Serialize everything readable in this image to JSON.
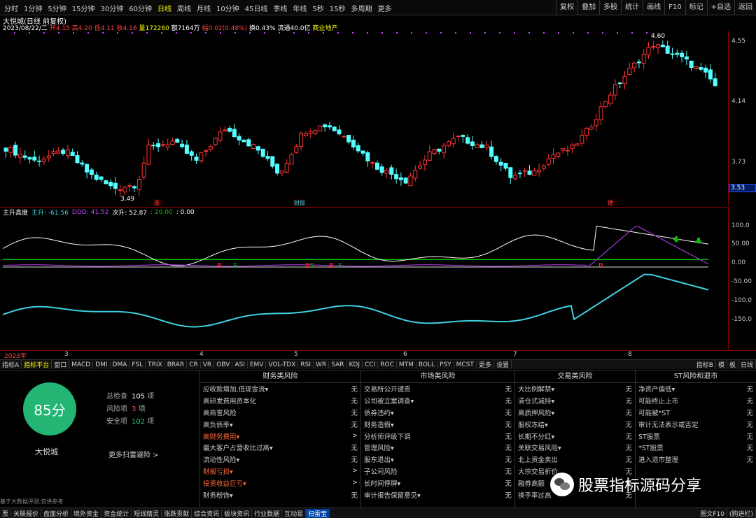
{
  "topbar": {
    "periods": [
      "分时",
      "1分钟",
      "5分钟",
      "15分钟",
      "30分钟",
      "60分钟",
      "日线",
      "周线",
      "月线",
      "10分钟",
      "45日线",
      "季线",
      "年线",
      "5秒",
      "15秒",
      "多周期",
      "更多"
    ],
    "active_period": "日线",
    "right": [
      "复权",
      "叠加",
      "多股",
      "统计",
      "画线",
      "F10",
      "标记",
      "+自选",
      "返回"
    ]
  },
  "stock": {
    "title": "大悦城(日线 前复权)",
    "date": "2023/08/22/二",
    "open": "开4.15",
    "high": "高4.20",
    "low": "低4.11",
    "close": "收4.16",
    "volume": "量172260",
    "amount": "额7164万",
    "change": "幅0.02(0.48%)",
    "turnover": "换0.43%",
    "float": "流通40.0亿",
    "sector": "商业地产"
  },
  "price_axis": [
    "4.55",
    "4.14",
    "3.73",
    "3.53"
  ],
  "current_price": "3.53",
  "annotations": {
    "high": "4.60",
    "low": "3.49",
    "tag_zhang": "涨",
    "tag_report": "财报",
    "tag_hui": "德"
  },
  "indicator": {
    "name": "主升高度",
    "z1": "主升: -61.56",
    "z2": "DDD: 41.52",
    "z3": "次升: 52.87",
    "z4": ": 20.00",
    "z5": ": 0.00",
    "axis": [
      "100.0",
      "50.00",
      "0.00",
      "-50.00",
      "-100.0",
      "-150.0"
    ]
  },
  "date_axis": [
    "2023年",
    "3",
    "4",
    "5",
    "6",
    "7",
    "8"
  ],
  "tabs": {
    "left": [
      "指标A",
      "指标平台",
      "窗口",
      "MACD",
      "DMI",
      "DMA",
      "FSL",
      "TRIX",
      "BRAR",
      "CR",
      "VR",
      "OBV",
      "ASI",
      "EMV",
      "VOL-TDX",
      "RSI",
      "WR",
      "SAR",
      "KDJ",
      "CCI",
      "ROC",
      "MTM",
      "BOLL",
      "PSY",
      "MCST",
      "更多",
      "设置"
    ],
    "active": "指标平台",
    "right": [
      "指标B",
      "模",
      "板",
      "日线"
    ]
  },
  "panel": {
    "score": "85分",
    "name": "大悦城",
    "total": {
      "label": "总检查",
      "value": "105",
      "unit": "项"
    },
    "risk": {
      "label": "风险项",
      "value": "3",
      "unit": "项"
    },
    "safe": {
      "label": "安全项",
      "value": "102",
      "unit": "项"
    },
    "more": "更多扫雷避险 >",
    "footnote": "基于大数据评测,仅供参考",
    "columns": [
      {
        "title": "财务类风险",
        "items": [
          {
            "label": "应收款增加,低现金流▾",
            "value": "无"
          },
          {
            "label": "高研发费用资本化",
            "value": "无"
          },
          {
            "label": "高商誉风险",
            "value": "无"
          },
          {
            "label": "高负债率▾",
            "value": "无"
          },
          {
            "label": "高财务费用▾",
            "value": ">",
            "warn": true
          },
          {
            "label": "最大客户占营收比过高▾",
            "value": "无"
          },
          {
            "label": "流动性风险▾",
            "value": "无"
          },
          {
            "label": "财报亏损▾",
            "value": ">",
            "warn": true
          },
          {
            "label": "投资收益巨亏▾",
            "value": ">",
            "warn": true
          },
          {
            "label": "财务粉饰▾",
            "value": "无"
          }
        ]
      },
      {
        "title": "市场类风险",
        "items": [
          {
            "label": "交易所公开谴责",
            "value": "无"
          },
          {
            "label": "公司被立案调查▾",
            "value": "无"
          },
          {
            "label": "债券违约▾",
            "value": "无"
          },
          {
            "label": "财务造假▾",
            "value": "无"
          },
          {
            "label": "分析师评级下调",
            "value": "无"
          },
          {
            "label": "管理风险▾",
            "value": "无"
          },
          {
            "label": "股东退出▾",
            "value": "无"
          },
          {
            "label": "子公司风险",
            "value": "无"
          },
          {
            "label": "长时间停牌▾",
            "value": "无"
          },
          {
            "label": "审计报告保留意见▾",
            "value": "无"
          }
        ]
      },
      {
        "title": "交易类风险",
        "items": [
          {
            "label": "大比例解禁▾",
            "value": "无"
          },
          {
            "label": "清仓式减持▾",
            "value": "无"
          },
          {
            "label": "高质押风险▾",
            "value": "无"
          },
          {
            "label": "股权冻结▾",
            "value": "无"
          },
          {
            "label": "长期不分红▾",
            "value": "无"
          },
          {
            "label": "关联交易风险▾",
            "value": "无"
          },
          {
            "label": "北上资金卖出",
            "value": "无"
          },
          {
            "label": "大宗交易折价",
            "value": "无"
          },
          {
            "label": "融券高额",
            "value": "无"
          },
          {
            "label": "换手率过高",
            "value": "无"
          }
        ]
      },
      {
        "title": "ST风险和退市",
        "items": [
          {
            "label": "净资产偏低▾",
            "value": "无"
          },
          {
            "label": "可能终止上市",
            "value": "无"
          },
          {
            "label": "可能被*ST",
            "value": "无"
          },
          {
            "label": "审计无法表示或否定",
            "value": "无"
          },
          {
            "label": "ST股票",
            "value": "无"
          },
          {
            "label": "*ST股票",
            "value": "无"
          },
          {
            "label": "进入退市整理",
            "value": "无"
          }
        ]
      }
    ]
  },
  "status": {
    "items": [
      "票",
      "关联报价",
      "盘面分析",
      "境外资金",
      "资金统计",
      "短线精灵",
      "涨跌贡献",
      "综合资讯",
      "板块资讯",
      "行业数据",
      "互动易",
      "扫雷宝"
    ],
    "active": "扫雷宝",
    "right": [
      "图文F10",
      "(购进栏)"
    ]
  },
  "watermark": "股票指标源码分享",
  "colors": {
    "up": "#ff3333",
    "down": "#54ffff",
    "line_white": "#ffffff",
    "line_magenta": "#c040ff",
    "line_cyan": "#40d0e0",
    "line_green": "#00c000",
    "score_green": "#22b573"
  }
}
